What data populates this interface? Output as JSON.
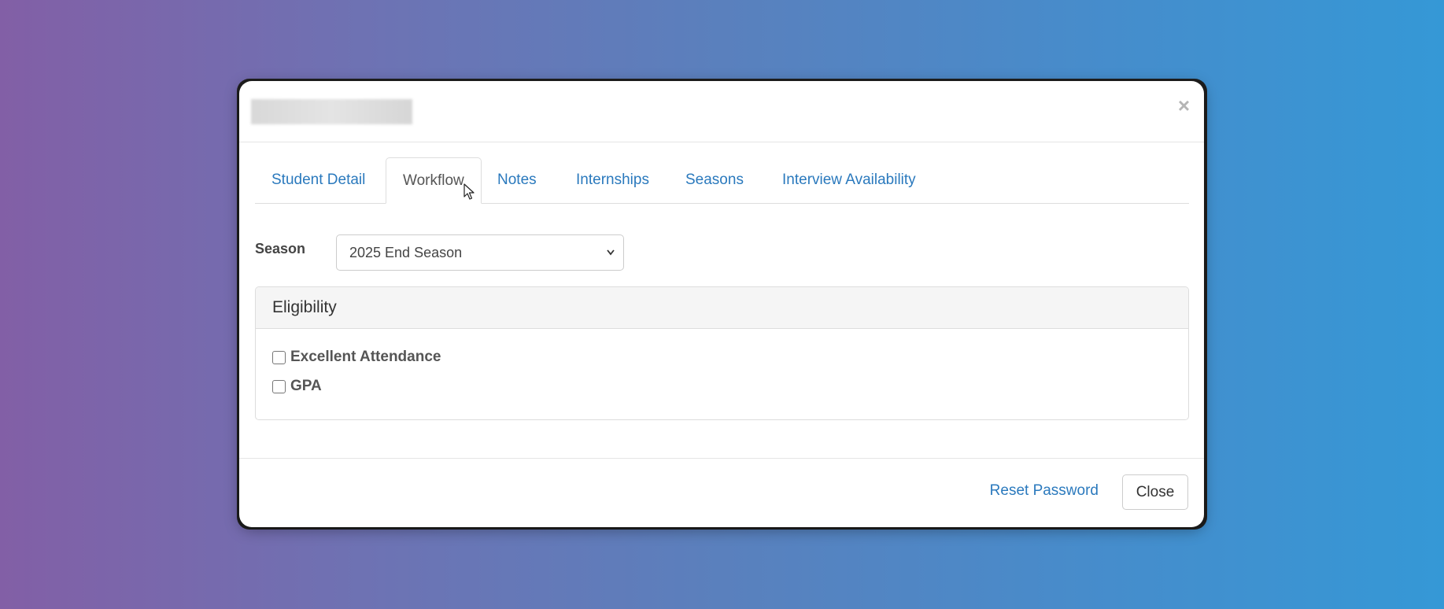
{
  "modal": {
    "close_icon": "×",
    "tabs": [
      {
        "label": "Student Detail"
      },
      {
        "label": "Workflow",
        "active": true
      },
      {
        "label": "Notes"
      },
      {
        "label": "Internships"
      },
      {
        "label": "Seasons"
      },
      {
        "label": "Interview Availability"
      }
    ],
    "season": {
      "label": "Season",
      "selected": "2025 End Season"
    },
    "eligibility": {
      "heading": "Eligibility",
      "items": [
        {
          "label": "Excellent Attendance",
          "checked": false
        },
        {
          "label": "GPA",
          "checked": false
        }
      ]
    },
    "footer": {
      "reset_password": "Reset Password",
      "close": "Close"
    }
  },
  "colors": {
    "link": "#2a79bd",
    "background_start": "#825fa6",
    "background_end": "#3598d6"
  }
}
